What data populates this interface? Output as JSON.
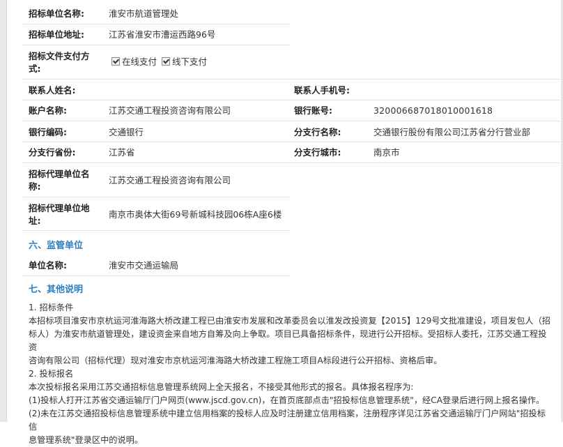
{
  "tender": {
    "unit_name_label": "招标单位名称:",
    "unit_name": "淮安市航道管理处",
    "unit_address_label": "招标单位地址:",
    "unit_address": "江苏省淮安市漕运西路96号",
    "payment_label_1": "招标文件支付方",
    "payment_label_2": "式:",
    "online_pay": "在线支付",
    "offline_pay": "线下支付",
    "contact_name_label": "联系人姓名:",
    "contact_name": "",
    "contact_mobile_label": "联系人手机号:",
    "contact_mobile": "",
    "account_name_label": "账户名称:",
    "account_name": "江苏交通工程投资咨询有限公司",
    "bank_account_label": "银行账号:",
    "bank_account": "32000668701801000161​8",
    "bank_code_label": "银行编码:",
    "bank_code": "交通银行",
    "branch_name_label": "分支行名称:",
    "branch_name": "交通银行股份有限公司江苏省分行营业部",
    "branch_province_label": "分支行省份:",
    "branch_province": "江苏省",
    "branch_city_label": "分支行城市:",
    "branch_city": "南京市",
    "agent_name_label_1": "招标代理单位名",
    "agent_name_label_2": "称:",
    "agent_name": "江苏交通工程投资咨询有限公司",
    "agent_address_label_1": "招标代理单位地",
    "agent_address_label_2": "址:",
    "agent_address": "南京市奥体大街69号新城科技园06栋A座6楼"
  },
  "supervision": {
    "heading": "六、监管单位",
    "unit_label": "单位名称:",
    "unit": "淮安市交通运输局"
  },
  "other": {
    "heading": "七、其他说明",
    "p1_title": "1. 招标条件",
    "p1_line1": "本招标项目淮安市京杭运河淮海路大桥改建工程已由淮安市发展和改革委员会以淮发改投资复【2015】129号文批准建设，项目发包人（招",
    "p1_line2": "标人）为淮安市航道管理处，建设资金来自地方自筹及向上争取。项目已具备招标条件，现进行公开招标。受招标人委托，江苏交通工程投资",
    "p1_line3": "咨询有限公司（招标代理）现对淮安市京杭运河淮海路大桥改建工程施工项目A标段进行公开招标、资格后审。",
    "p2_title": "2. 投标报名",
    "p2_line1": "本次投标报名采用江苏交通招标信息管理系统网上全天报名，不接受其他形式的报名。具体报名程序为:",
    "p2_line2": "(1)投标人打开江苏省交通运输厅门户网页(www.jscd.gov.cn)，在首页底部点击\"招投标信息管理系统\"，经CA登录后进行网上报名操作。",
    "p2_line3": "(2)未在江苏交通招投标信息管理系统中建立信用档案的投标人应及时注册建立信用档案，注册程序详见江苏省交通运输厅门户网站\"招投标信",
    "p2_line4": "息管理系统\"登录区中的说明。"
  }
}
